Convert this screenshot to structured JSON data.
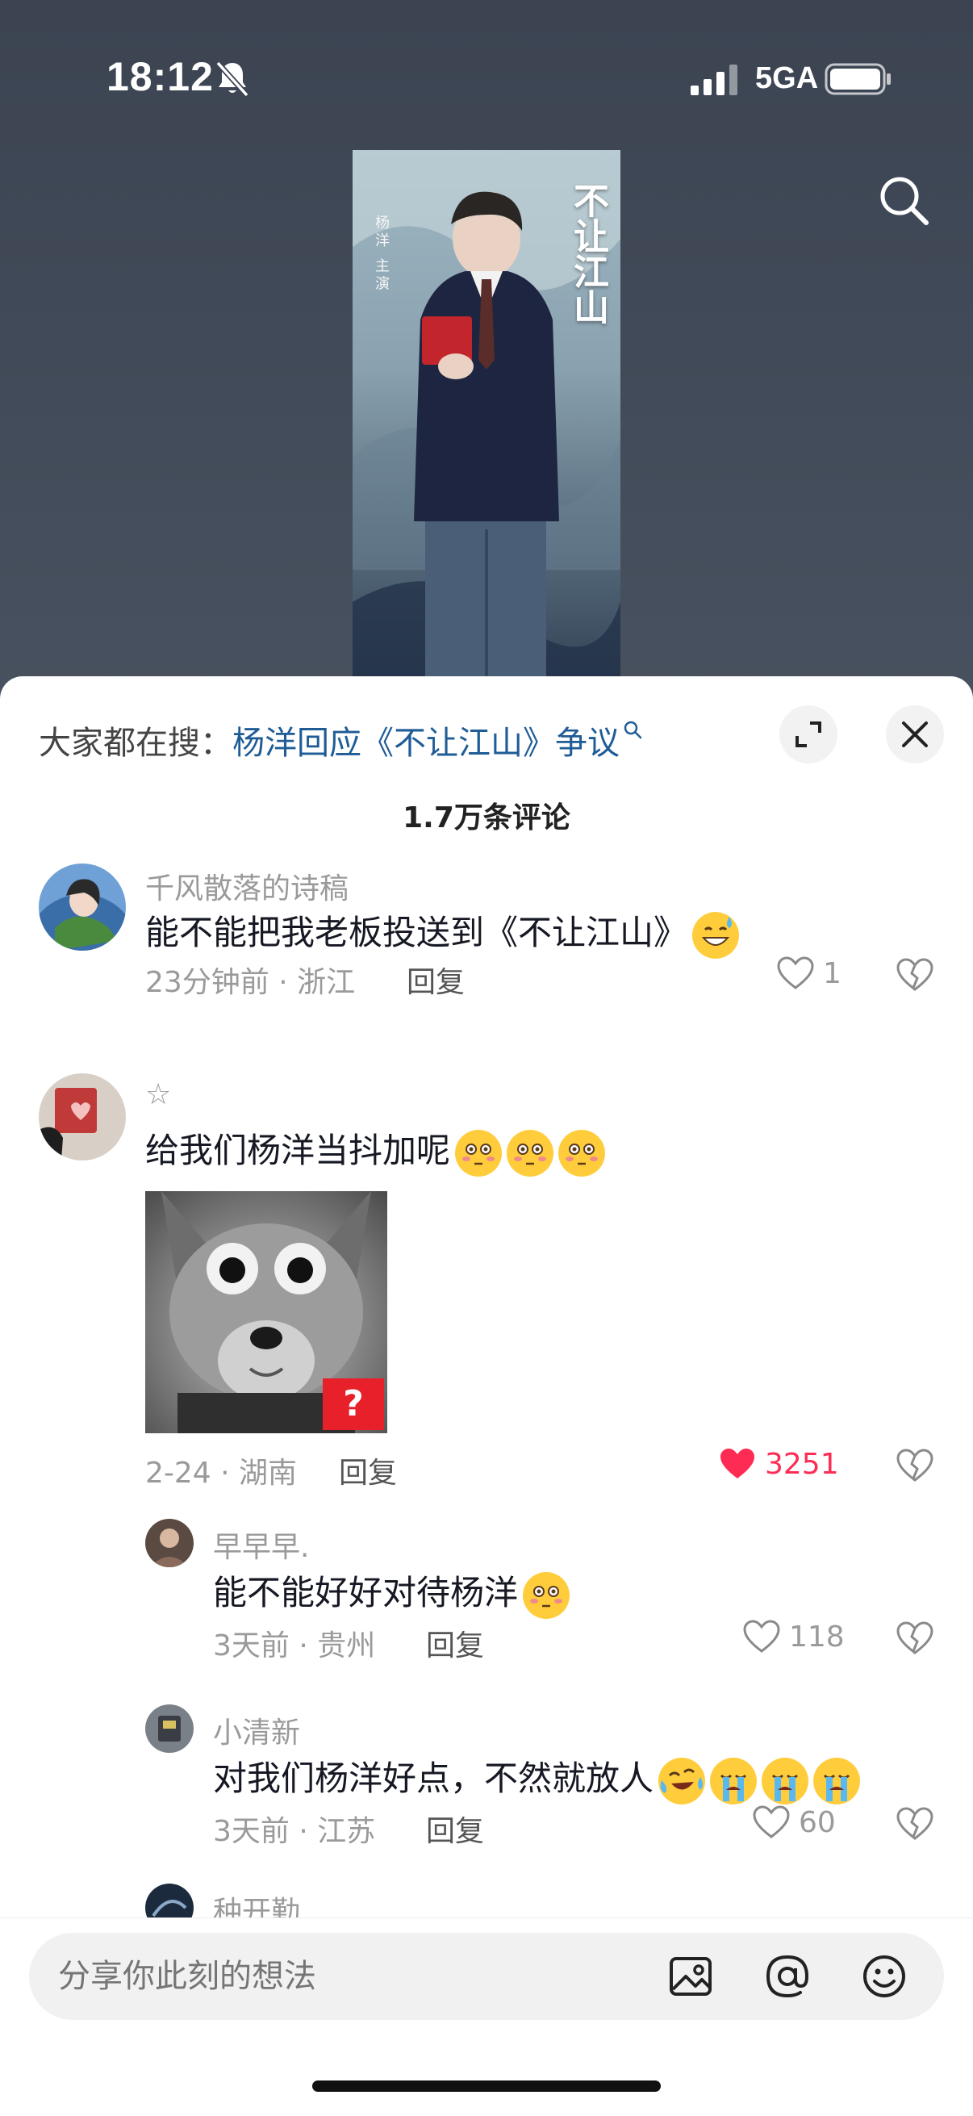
{
  "status_bar": {
    "time": "18:12",
    "network": "5GA",
    "icons": [
      "bell-muted-icon",
      "signal-icon",
      "battery-icon"
    ]
  },
  "video": {
    "poster_title": "不让江山",
    "poster_credit": "杨洋 主演",
    "icons": [
      "search-icon"
    ]
  },
  "sheet": {
    "hot_search_prefix": "大家都在搜：",
    "hot_search_query": "杨洋回应《不让江山》争议",
    "comment_count": "1.7万条评论",
    "icons": [
      "expand-icon",
      "close-icon",
      "search-small-icon"
    ]
  },
  "comments": [
    {
      "name": "千风散落的诗稿",
      "text": "能不能把我老板投送到《不让江山》",
      "emojis": [
        "sweat-smile-emoji"
      ],
      "time": "23分钟前",
      "location": "浙江",
      "reply": "回复",
      "likes": "1",
      "liked": false
    },
    {
      "name": "☆",
      "text": "给我们杨洋当抖加呢",
      "emojis": [
        "flushed-emoji",
        "flushed-emoji",
        "flushed-emoji"
      ],
      "has_image": true,
      "image_badge": "?",
      "time": "2-24",
      "location": "湖南",
      "reply": "回复",
      "likes": "3251",
      "liked": true,
      "replies": [
        {
          "name": "早早早.",
          "text": "能不能好好对待杨洋",
          "emojis": [
            "flushed-emoji"
          ],
          "time": "3天前",
          "location": "贵州",
          "reply": "回复",
          "likes": "118",
          "liked": false
        },
        {
          "name": "小清新",
          "text": "对我们杨洋好点，不然就放人",
          "emojis": [
            "rolling-tears-emoji",
            "crying-emoji",
            "crying-emoji",
            "crying-emoji"
          ],
          "time": "3天前",
          "location": "江苏",
          "reply": "回复",
          "likes": "60",
          "liked": false
        },
        {
          "name": "种开勤"
        }
      ]
    }
  ],
  "composer": {
    "placeholder": "分享你此刻的想法",
    "icons": [
      "image-icon",
      "at-icon",
      "emoji-icon"
    ]
  },
  "colors": {
    "accent_like": "#fe2c55",
    "hot_search_link": "#1f5c96",
    "muted_text": "#9a9a9a"
  }
}
